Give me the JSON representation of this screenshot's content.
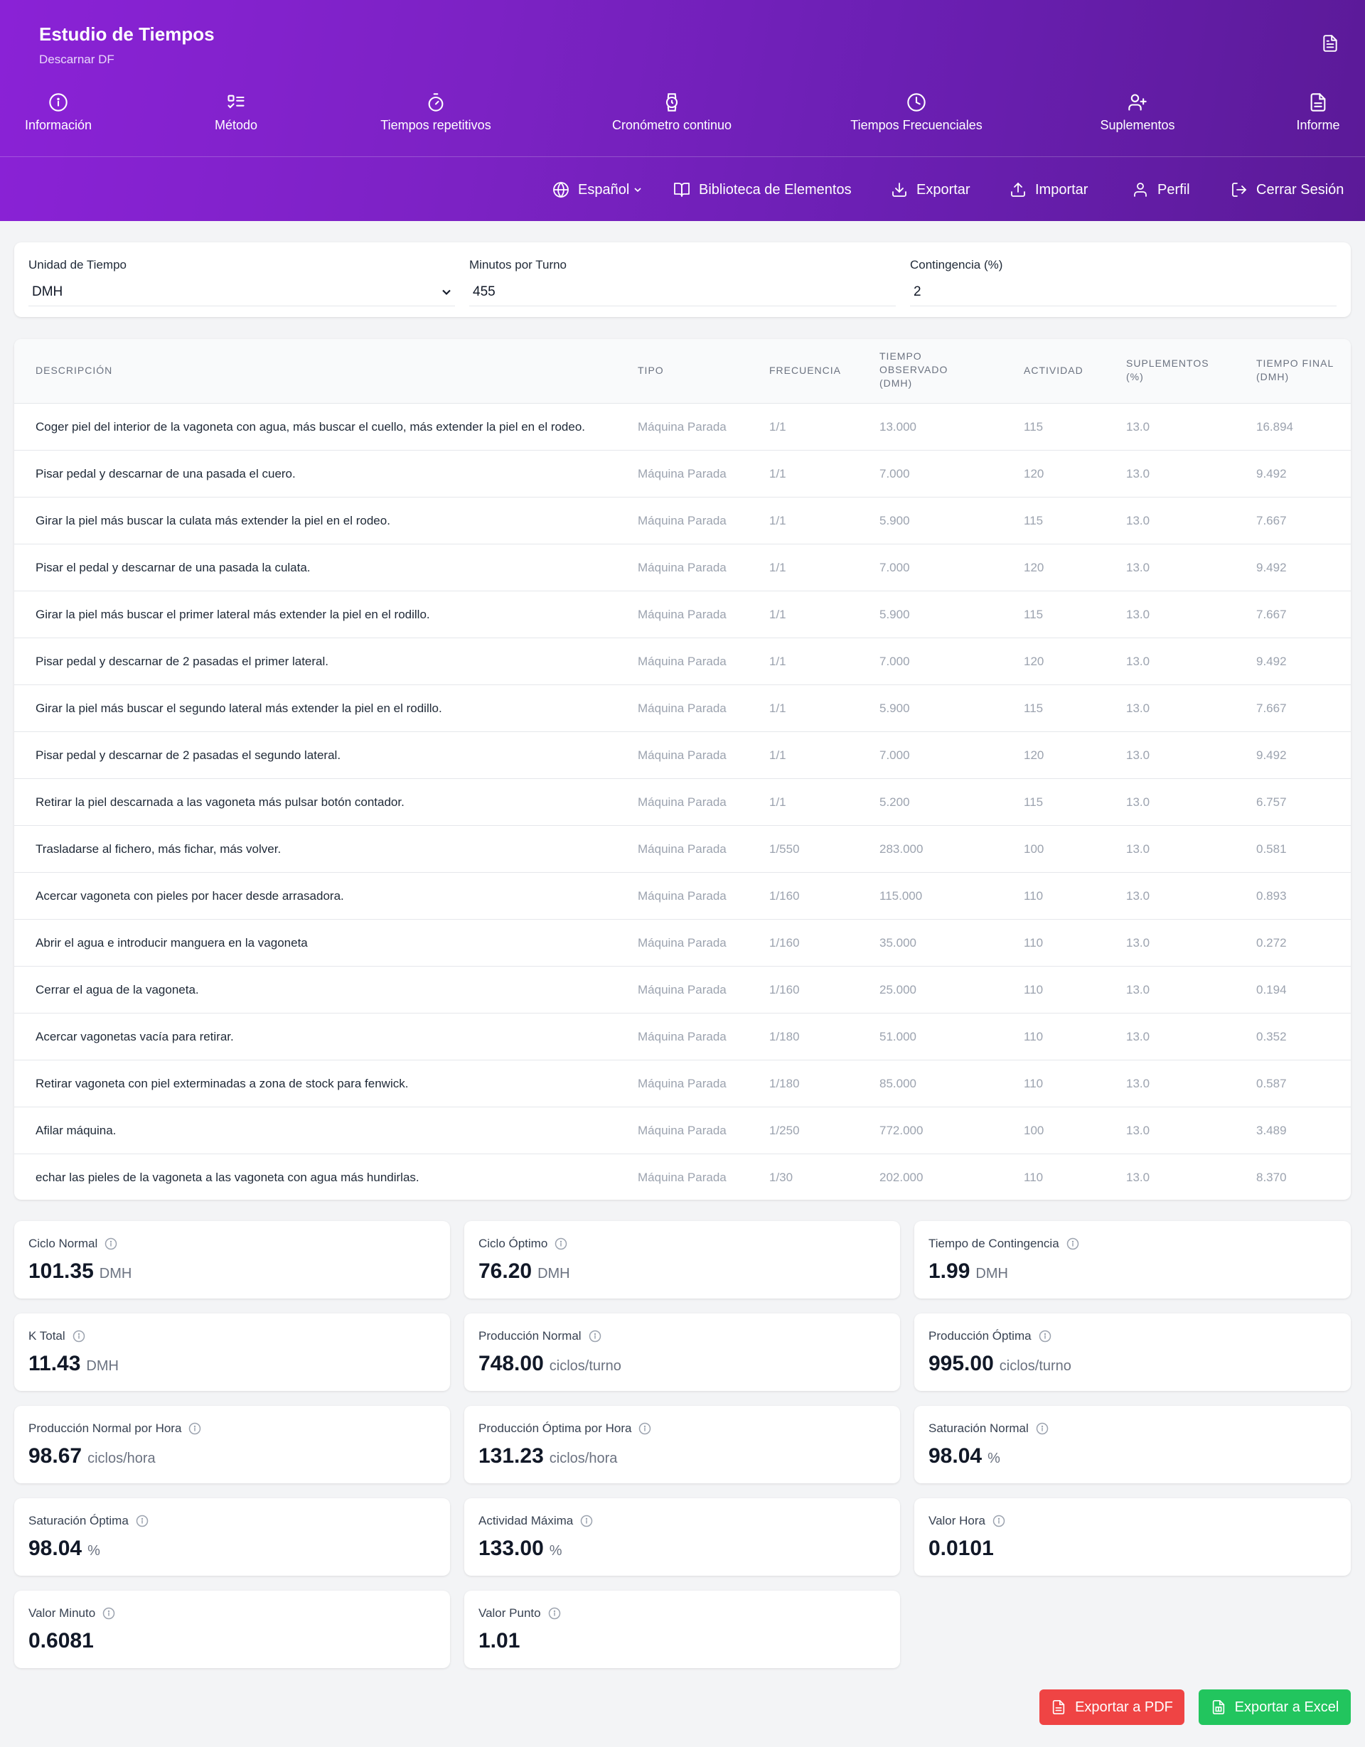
{
  "header": {
    "title": "Estudio de Tiempos",
    "subtitle": "Descarnar DF",
    "tabs": [
      {
        "label": "Información",
        "icon": "info-icon"
      },
      {
        "label": "Método",
        "icon": "list-checks-icon"
      },
      {
        "label": "Tiempos repetitivos",
        "icon": "timer-icon"
      },
      {
        "label": "Cronómetro continuo",
        "icon": "watch-icon"
      },
      {
        "label": "Tiempos Frecuenciales",
        "icon": "clock-icon"
      },
      {
        "label": "Suplementos",
        "icon": "user-plus-icon"
      },
      {
        "label": "Informe",
        "icon": "file-text-icon"
      }
    ],
    "toolbar": {
      "language": "Español",
      "library": "Biblioteca de Elementos",
      "export": "Exportar",
      "import": "Importar",
      "profile": "Perfil",
      "logout": "Cerrar Sesión"
    }
  },
  "settings": {
    "time_unit_label": "Unidad de Tiempo",
    "time_unit_value": "DMH",
    "minutes_label": "Minutos por Turno",
    "minutes_value": "455",
    "contingency_label": "Contingencia (%)",
    "contingency_value": "2"
  },
  "table": {
    "headers": {
      "desc": "Descripción",
      "type": "Tipo",
      "freq": "Frecuencia",
      "obs": "Tiempo Observado (DMH)",
      "act": "Actividad",
      "sup": "Suplementos (%)",
      "final": "Tiempo Final (DMH)"
    },
    "rows": [
      {
        "desc": "Coger piel del interior de la vagoneta con agua, más buscar el cuello, más extender la piel en el rodeo.",
        "type": "Máquina Parada",
        "freq": "1/1",
        "obs": "13.000",
        "act": "115",
        "sup": "13.0",
        "final": "16.894"
      },
      {
        "desc": "Pisar pedal y descarnar de una pasada el cuero.",
        "type": "Máquina Parada",
        "freq": "1/1",
        "obs": "7.000",
        "act": "120",
        "sup": "13.0",
        "final": "9.492"
      },
      {
        "desc": "Girar la piel más buscar la culata más extender la piel en el rodeo.",
        "type": "Máquina Parada",
        "freq": "1/1",
        "obs": "5.900",
        "act": "115",
        "sup": "13.0",
        "final": "7.667"
      },
      {
        "desc": "Pisar el pedal y descarnar de una pasada la culata.",
        "type": "Máquina Parada",
        "freq": "1/1",
        "obs": "7.000",
        "act": "120",
        "sup": "13.0",
        "final": "9.492"
      },
      {
        "desc": "Girar la piel más buscar el primer lateral más extender la piel en el rodillo.",
        "type": "Máquina Parada",
        "freq": "1/1",
        "obs": "5.900",
        "act": "115",
        "sup": "13.0",
        "final": "7.667"
      },
      {
        "desc": "Pisar pedal y descarnar de 2 pasadas el primer lateral.",
        "type": "Máquina Parada",
        "freq": "1/1",
        "obs": "7.000",
        "act": "120",
        "sup": "13.0",
        "final": "9.492"
      },
      {
        "desc": "Girar la piel más buscar el segundo lateral más extender la piel en el rodillo.",
        "type": "Máquina Parada",
        "freq": "1/1",
        "obs": "5.900",
        "act": "115",
        "sup": "13.0",
        "final": "7.667"
      },
      {
        "desc": "Pisar pedal y descarnar de 2 pasadas el segundo lateral.",
        "type": "Máquina Parada",
        "freq": "1/1",
        "obs": "7.000",
        "act": "120",
        "sup": "13.0",
        "final": "9.492"
      },
      {
        "desc": "Retirar la piel descarnada a las vagoneta más pulsar botón contador.",
        "type": "Máquina Parada",
        "freq": "1/1",
        "obs": "5.200",
        "act": "115",
        "sup": "13.0",
        "final": "6.757"
      },
      {
        "desc": "Trasladarse al fichero, más fichar, más volver.",
        "type": "Máquina Parada",
        "freq": "1/550",
        "obs": "283.000",
        "act": "100",
        "sup": "13.0",
        "final": "0.581"
      },
      {
        "desc": "Acercar vagoneta con pieles por hacer desde arrasadora.",
        "type": "Máquina Parada",
        "freq": "1/160",
        "obs": "115.000",
        "act": "110",
        "sup": "13.0",
        "final": "0.893"
      },
      {
        "desc": "Abrir el agua e introducir manguera en la vagoneta",
        "type": "Máquina Parada",
        "freq": "1/160",
        "obs": "35.000",
        "act": "110",
        "sup": "13.0",
        "final": "0.272"
      },
      {
        "desc": "Cerrar el agua de la vagoneta.",
        "type": "Máquina Parada",
        "freq": "1/160",
        "obs": "25.000",
        "act": "110",
        "sup": "13.0",
        "final": "0.194"
      },
      {
        "desc": "Acercar vagonetas vacía para retirar.",
        "type": "Máquina Parada",
        "freq": "1/180",
        "obs": "51.000",
        "act": "110",
        "sup": "13.0",
        "final": "0.352"
      },
      {
        "desc": "Retirar vagoneta con piel exterminadas a zona de stock para fenwick.",
        "type": "Máquina Parada",
        "freq": "1/180",
        "obs": "85.000",
        "act": "110",
        "sup": "13.0",
        "final": "0.587"
      },
      {
        "desc": "Afilar máquina.",
        "type": "Máquina Parada",
        "freq": "1/250",
        "obs": "772.000",
        "act": "100",
        "sup": "13.0",
        "final": "3.489"
      },
      {
        "desc": "echar las pieles de la vagoneta a las vagoneta con agua más hundirlas.",
        "type": "Máquina Parada",
        "freq": "1/30",
        "obs": "202.000",
        "act": "110",
        "sup": "13.0",
        "final": "8.370"
      }
    ]
  },
  "metrics": [
    {
      "label": "Ciclo Normal",
      "value": "101.35",
      "unit": "DMH"
    },
    {
      "label": "Ciclo Óptimo",
      "value": "76.20",
      "unit": "DMH"
    },
    {
      "label": "Tiempo de Contingencia",
      "value": "1.99",
      "unit": "DMH"
    },
    {
      "label": "K Total",
      "value": "11.43",
      "unit": "DMH"
    },
    {
      "label": "Producción Normal",
      "value": "748.00",
      "unit": "ciclos/turno"
    },
    {
      "label": "Producción Óptima",
      "value": "995.00",
      "unit": "ciclos/turno"
    },
    {
      "label": "Producción Normal por Hora",
      "value": "98.67",
      "unit": "ciclos/hora"
    },
    {
      "label": "Producción Óptima por Hora",
      "value": "131.23",
      "unit": "ciclos/hora"
    },
    {
      "label": "Saturación Normal",
      "value": "98.04",
      "unit": "%"
    },
    {
      "label": "Saturación Óptima",
      "value": "98.04",
      "unit": "%"
    },
    {
      "label": "Actividad Máxima",
      "value": "133.00",
      "unit": "%"
    },
    {
      "label": "Valor Hora",
      "value": "0.0101",
      "unit": ""
    },
    {
      "label": "Valor Minuto",
      "value": "0.6081",
      "unit": ""
    },
    {
      "label": "Valor Punto",
      "value": "1.01",
      "unit": ""
    }
  ],
  "actions": {
    "pdf": "Exportar a PDF",
    "excel": "Exportar a Excel"
  },
  "colors": {
    "header_start": "#8a22d6",
    "header_end": "#5b1a98",
    "pdf_button": "#ef4444",
    "excel_button": "#22c55e"
  }
}
